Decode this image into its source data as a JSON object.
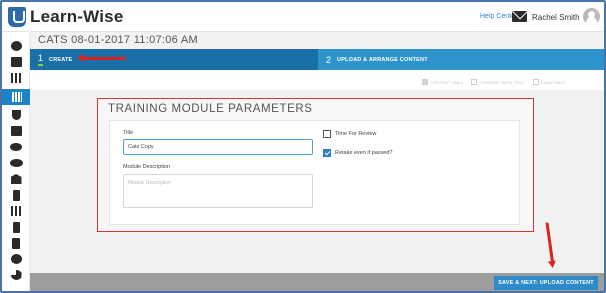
{
  "app": {
    "logo_text": "Learn-Wise"
  },
  "header": {
    "help_label": "Help Center",
    "user_name": "Rachel Smith"
  },
  "page": {
    "title": "CATS 08-01-2017 11:07:06 AM"
  },
  "steps": [
    {
      "number": "1",
      "label": "CREATE",
      "active": true
    },
    {
      "number": "2",
      "label": "UPLOAD & ARRANGE CONTENT",
      "active": false
    }
  ],
  "filters": [
    {
      "label": "CONTENT ONLY",
      "checked": true
    },
    {
      "label": "CONTENT WITH TEST",
      "checked": false
    },
    {
      "label": "EXAM ONLY",
      "checked": false
    }
  ],
  "params": {
    "heading": "TRAINING MODULE PARAMETERS",
    "title_label": "Title",
    "title_value": "Cats Copy",
    "description_label": "Module Description",
    "description_placeholder": "Module Description",
    "time_for_review_label": "Time For Review",
    "time_for_review_checked": false,
    "retake_label": "Retake even if passed?",
    "retake_checked": true
  },
  "sidebar": {
    "icons": [
      "dashboard-icon",
      "inbox-icon",
      "library-icon",
      "modules-grid-icon",
      "trophy-icon",
      "presentation-icon",
      "users-icon",
      "groups-icon",
      "mail-icon",
      "certificate-icon",
      "report-icon",
      "document-icon",
      "tablet-icon",
      "settings-icon",
      "analytics-icon"
    ],
    "active_index": 3
  },
  "footer": {
    "primary_button": "SAVE & NEXT: UPLOAD CONTENT"
  },
  "colors": {
    "accent": "#2e8bc9",
    "step_active": "#1b6fa8",
    "annotation": "#d9231e"
  }
}
